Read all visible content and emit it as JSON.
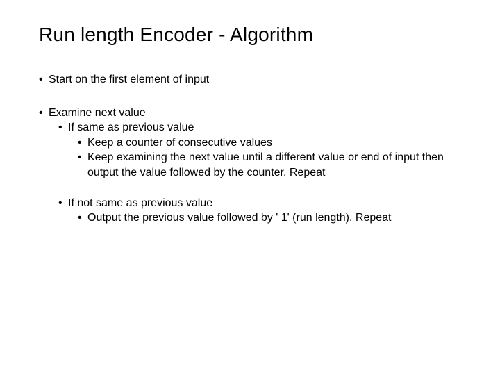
{
  "title": "Run length Encoder - Algorithm",
  "bullets": {
    "b1": "Start on the first element of input",
    "b2": "Examine next value",
    "b2a": "If same as previous value",
    "b2a1": "Keep a counter of consecutive values",
    "b2a2": "Keep examining the next value until a different value or end of input then output the value followed by the counter. Repeat",
    "b2b": "If not same as previous value",
    "b2b1": "Output the previous value followed by ' 1' (run length). Repeat"
  }
}
